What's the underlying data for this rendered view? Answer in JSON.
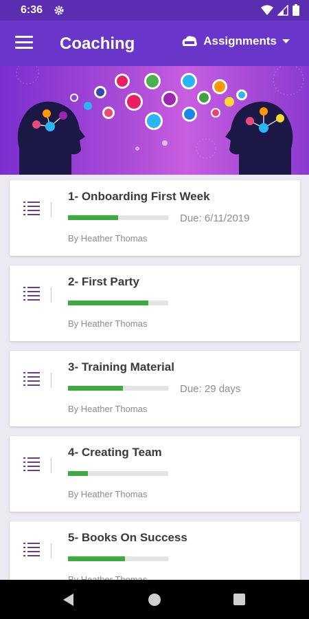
{
  "status_bar": {
    "time": "6:36"
  },
  "app_bar": {
    "title": "Coaching",
    "dropdown_label": "Assignments"
  },
  "assignments": [
    {
      "title": "1- Onboarding First Week",
      "due": "Due: 6/11/2019",
      "author": "By Heather Thomas",
      "progress": 0.5
    },
    {
      "title": "2- First Party",
      "due": "",
      "author": "By Heather Thomas",
      "progress": 0.8
    },
    {
      "title": "3- Training Material",
      "due": "Due: 29 days",
      "author": "By Heather Thomas",
      "progress": 0.55
    },
    {
      "title": "4- Creating Team",
      "due": "",
      "author": "By Heather Thomas",
      "progress": 0.2
    },
    {
      "title": "5- Books On Success",
      "due": "",
      "author": "By Heather Thomas",
      "progress": 0.57
    }
  ],
  "colors": {
    "status_bar": "#5b2db0",
    "app_bar": "#6a36c9",
    "progress": "#3daa3f",
    "icon": "#5b3bb8"
  },
  "icons": {
    "menu": "hamburger-menu",
    "dropdown": "cloud-inbox",
    "list": "numbered-list"
  }
}
